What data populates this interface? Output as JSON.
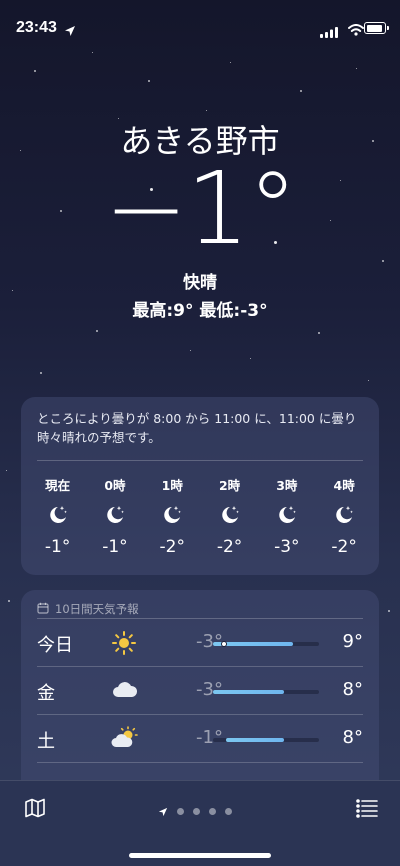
{
  "status_bar": {
    "time": "23:43",
    "location_icon": "location-arrow-icon",
    "signal_icon": "cellular-signal-icon",
    "wifi_icon": "wifi-icon",
    "battery_icon": "battery-icon"
  },
  "location": {
    "city": "あきる野市",
    "temperature": "−1°",
    "condition": "快晴",
    "high_low": "最高:9°  最低:-3°"
  },
  "hourly": {
    "summary": "ところにより曇りが 8:00 から 11:00 に、11:00 に曇り時々晴れの予想です。",
    "hours": [
      {
        "label": "現在",
        "icon": "moon-stars-icon",
        "temp": "-1°"
      },
      {
        "label": "0時",
        "icon": "moon-stars-icon",
        "temp": "-1°"
      },
      {
        "label": "1時",
        "icon": "moon-stars-icon",
        "temp": "-2°"
      },
      {
        "label": "2時",
        "icon": "moon-stars-icon",
        "temp": "-2°"
      },
      {
        "label": "3時",
        "icon": "moon-stars-icon",
        "temp": "-3°"
      },
      {
        "label": "4時",
        "icon": "moon-stars-icon",
        "temp": "-2°"
      }
    ]
  },
  "daily": {
    "header": "10日間天気予報",
    "header_icon": "calendar-icon",
    "days": [
      {
        "name": "今日",
        "icon": "sun-icon",
        "low": "-3°",
        "high": "9°",
        "range_start": 0.0,
        "range_end": 0.75,
        "current": 0.1
      },
      {
        "name": "金",
        "icon": "cloud-icon",
        "low": "-3°",
        "high": "8°",
        "range_start": 0.0,
        "range_end": 0.67
      },
      {
        "name": "土",
        "icon": "partly-cloudy-icon",
        "low": "-1°",
        "high": "8°",
        "range_start": 0.12,
        "range_end": 0.67
      }
    ]
  },
  "bottom_bar": {
    "map_icon": "map-icon",
    "list_icon": "list-icon",
    "page_count": 4,
    "current_page_icon": "location-arrow-icon"
  }
}
